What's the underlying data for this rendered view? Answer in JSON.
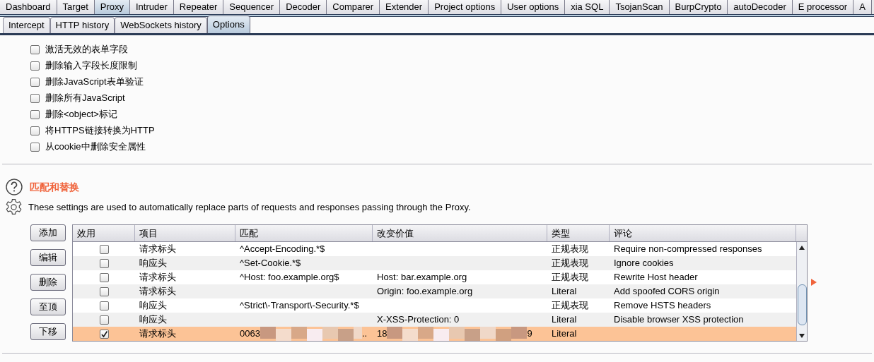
{
  "main_tabs": [
    {
      "label": "Dashboard",
      "selected": false
    },
    {
      "label": "Target",
      "selected": false
    },
    {
      "label": "Proxy",
      "selected": true
    },
    {
      "label": "Intruder",
      "selected": false
    },
    {
      "label": "Repeater",
      "selected": false
    },
    {
      "label": "Sequencer",
      "selected": false
    },
    {
      "label": "Decoder",
      "selected": false
    },
    {
      "label": "Comparer",
      "selected": false
    },
    {
      "label": "Extender",
      "selected": false
    },
    {
      "label": "Project options",
      "selected": false
    },
    {
      "label": "User options",
      "selected": false
    },
    {
      "label": "xia SQL",
      "selected": false
    },
    {
      "label": "TsojanScan",
      "selected": false
    },
    {
      "label": "BurpCrypto",
      "selected": false
    },
    {
      "label": "autoDecoder",
      "selected": false
    },
    {
      "label": "E processor",
      "selected": false
    },
    {
      "label": "A",
      "selected": false
    }
  ],
  "sub_tabs": [
    {
      "label": "Intercept",
      "selected": false
    },
    {
      "label": "HTTP history",
      "selected": false
    },
    {
      "label": "WebSockets history",
      "selected": false
    },
    {
      "label": "Options",
      "selected": true
    }
  ],
  "options": [
    {
      "label": "激活无效的表单字段",
      "checked": false
    },
    {
      "label": "删除输入字段长度限制",
      "checked": false
    },
    {
      "label": "删除JavaScript表单验证",
      "checked": false
    },
    {
      "label": "删除所有JavaScript",
      "checked": false
    },
    {
      "label": "删除<object>标记",
      "checked": false
    },
    {
      "label": "将HTTPS链接转换为HTTP",
      "checked": false
    },
    {
      "label": "从cookie中删除安全属性",
      "checked": false
    }
  ],
  "section": {
    "title": "匹配和替换",
    "description": "These settings are used to automatically replace parts of requests and responses passing through the Proxy."
  },
  "buttons": [
    "添加",
    "编辑",
    "删除",
    "至顶",
    "下移"
  ],
  "table": {
    "columns": [
      "效用",
      "项目",
      "匹配",
      "改变价值",
      "类型",
      "评论"
    ],
    "rows": [
      {
        "enabled": false,
        "selected": false,
        "item": "请求标头",
        "match": "^Accept-Encoding.*$",
        "replace": "",
        "type": "正规表现",
        "comment": "Require non-compressed responses"
      },
      {
        "enabled": false,
        "selected": false,
        "item": "响应头",
        "match": "^Set-Cookie.*$",
        "replace": "",
        "type": "正规表现",
        "comment": "Ignore cookies"
      },
      {
        "enabled": false,
        "selected": false,
        "item": "请求标头",
        "match": "^Host: foo.example.org$",
        "replace": "Host: bar.example.org",
        "type": "正规表现",
        "comment": "Rewrite Host header"
      },
      {
        "enabled": false,
        "selected": false,
        "item": "请求标头",
        "match": "",
        "replace": "Origin: foo.example.org",
        "type": "Literal",
        "comment": "Add spoofed CORS origin"
      },
      {
        "enabled": false,
        "selected": false,
        "item": "响应头",
        "match": "^Strict\\-Transport\\-Security.*$",
        "replace": "",
        "type": "正规表现",
        "comment": "Remove HSTS headers"
      },
      {
        "enabled": false,
        "selected": false,
        "item": "响应头",
        "match": "",
        "replace": "X-XSS-Protection: 0",
        "type": "Literal",
        "comment": "Disable browser XSS protection"
      },
      {
        "enabled": true,
        "selected": true,
        "item": "请求标头",
        "match": "0063",
        "match_end": "..",
        "replace": "18",
        "replace_end": "9",
        "redacted": true,
        "type": "Literal",
        "comment": ""
      }
    ]
  }
}
